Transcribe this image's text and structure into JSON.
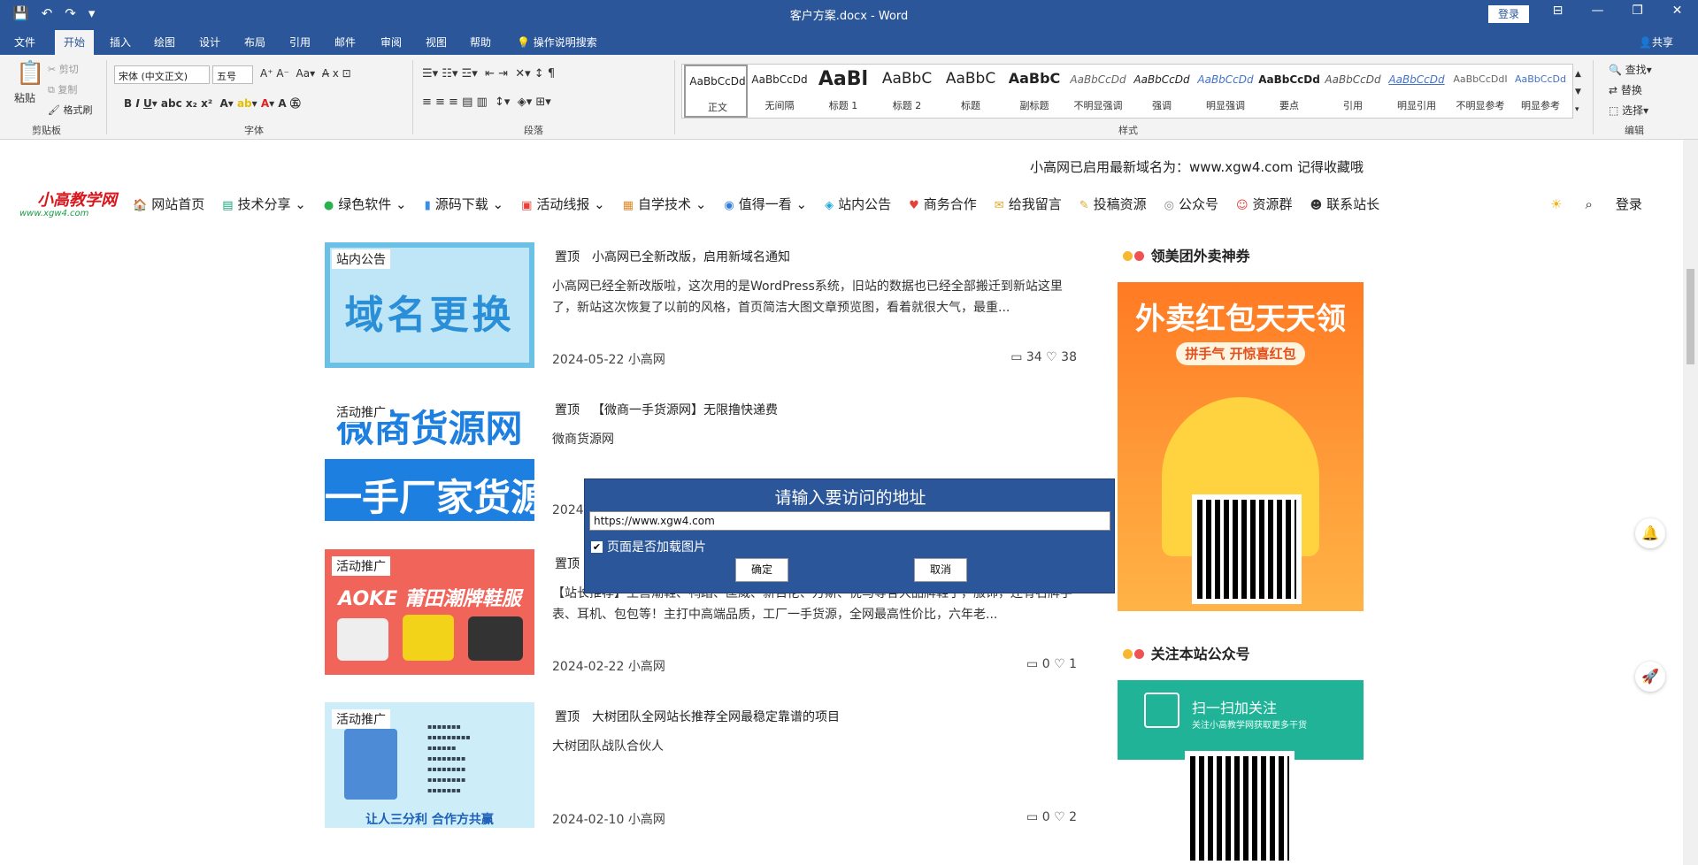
{
  "titlebar": {
    "doc_title": "客户方案.docx  -  Word",
    "login": "登录",
    "qat": [
      "💾",
      "↶",
      "↷",
      "▾"
    ],
    "winctl": [
      "⊟",
      "—",
      "❐",
      "✕"
    ]
  },
  "tabs": [
    "文件",
    "开始",
    "插入",
    "绘图",
    "设计",
    "布局",
    "引用",
    "邮件",
    "审阅",
    "视图",
    "帮助"
  ],
  "tell_me": "操作说明搜索",
  "share": "共享",
  "ribbon": {
    "clipboard": {
      "label": "剪贴板",
      "paste": "粘贴",
      "cut": "剪切",
      "copy": "复制",
      "format_painter": "格式刷"
    },
    "font": {
      "label": "字体",
      "font_name": "宋体 (中文正文)",
      "font_size": "五号"
    },
    "paragraph": {
      "label": "段落"
    },
    "styles": {
      "label": "样式",
      "items": [
        {
          "preview": "AaBbCcDd",
          "name": "正文"
        },
        {
          "preview": "AaBbCcDd",
          "name": "无间隔"
        },
        {
          "preview": "AaBl",
          "name": "标题 1"
        },
        {
          "preview": "AaBbC",
          "name": "标题 2"
        },
        {
          "preview": "AaBbC",
          "name": "标题"
        },
        {
          "preview": "AaBbC",
          "name": "副标题"
        },
        {
          "preview": "AaBbCcDd",
          "name": "不明显强调"
        },
        {
          "preview": "AaBbCcDd",
          "name": "强调"
        },
        {
          "preview": "AaBbCcDd",
          "name": "明显强调"
        },
        {
          "preview": "AaBbCcDd",
          "name": "要点"
        },
        {
          "preview": "AaBbCcDd",
          "name": "引用"
        },
        {
          "preview": "AaBbCcDd",
          "name": "明显引用"
        },
        {
          "preview": "AaBbCcDdI",
          "name": "不明显参考"
        },
        {
          "preview": "AaBbCcDd",
          "name": "明显参考"
        }
      ]
    },
    "editing": {
      "label": "编辑",
      "find": "查找",
      "replace": "替换",
      "select": "选择"
    }
  },
  "site": {
    "notice": "小高网已启用最新域名为：www.xgw4.com 记得收藏哦",
    "logo_text": "小高教学网",
    "logo_sub": "www.xgw4.com",
    "nav": [
      {
        "icon": "🏠",
        "label": "网站首页"
      },
      {
        "icon": "▤",
        "label": "技术分享"
      },
      {
        "icon": "●",
        "label": "绿色软件"
      },
      {
        "icon": "▮",
        "label": "源码下载"
      },
      {
        "icon": "▣",
        "label": "活动线报"
      },
      {
        "icon": "▦",
        "label": "自学技术"
      },
      {
        "icon": "◉",
        "label": "值得一看"
      },
      {
        "icon": "◈",
        "label": "站内公告"
      },
      {
        "icon": "♥",
        "label": "商务合作"
      },
      {
        "icon": "✉",
        "label": "给我留言"
      },
      {
        "icon": "✎",
        "label": "投稿资源"
      },
      {
        "icon": "◎",
        "label": "公众号"
      },
      {
        "icon": "☺",
        "label": "资源群"
      },
      {
        "icon": "☻",
        "label": "联系站长"
      }
    ],
    "login": "登录"
  },
  "posts": [
    {
      "tag": "站内公告",
      "img_text": "域名更换",
      "pin": "置顶",
      "title": "小高网已全新改版，启用新域名通知",
      "excerpt": "小高网已经全新改版啦，这次用的是WordPress系统，旧站的数据也已经全部搬迁到新站这里了，新站这次恢复了以前的风格，首页简洁大图文章预览图，看着就很大气，最重...",
      "date": "2024-05-22",
      "author": "小高网",
      "comments": "34",
      "likes": "38"
    },
    {
      "tag": "活动推广",
      "img_text": "微商货源网",
      "img_text2": "一手厂家货源",
      "pin": "置顶",
      "title": "【微商一手货源网】无限撸快递费",
      "excerpt": "微商货源网",
      "date": "2024",
      "author": "",
      "comments": "",
      "likes": ""
    },
    {
      "tag": "活动推广",
      "img_text": "AOKE 莆田潮牌鞋服",
      "pin": "置顶",
      "title": "",
      "excerpt": "【站长推荐】主营潮鞋、鸭踏、匡威、新百伦、万斯、优马等各大品牌鞋子，服饰，还有名牌手表、耳机、包包等！主打中高端品质，工厂一手货源，全网最高性价比，六年老...",
      "date": "2024-02-22",
      "author": "小高网",
      "comments": "0",
      "likes": "1"
    },
    {
      "tag": "活动推广",
      "img_text": "让人三分利 合作方共赢",
      "pin": "置顶",
      "title": "大树团队全网站长推荐全网最稳定靠谱的项目",
      "excerpt": "大树团队战队合伙人",
      "date": "2024-02-10",
      "author": "小高网",
      "comments": "0",
      "likes": "2"
    }
  ],
  "sidebar": {
    "head1": "领美团外卖神券",
    "ad1_title": "外卖红包天天领",
    "ad1_sub": "拼手气 开惊喜红包",
    "head2": "关注本站公众号",
    "ad2_title": "扫一扫加关注",
    "ad2_sub": "关注小高教学网获取更多干货"
  },
  "dialog": {
    "title": "请输入要访问的地址",
    "url": "https://www.xgw4.com",
    "load_images_label": "页面是否加载图片",
    "load_images": true,
    "ok": "确定",
    "cancel": "取消"
  },
  "colors": {
    "word_blue": "#2b579a",
    "accent_red": "#d8161b"
  }
}
